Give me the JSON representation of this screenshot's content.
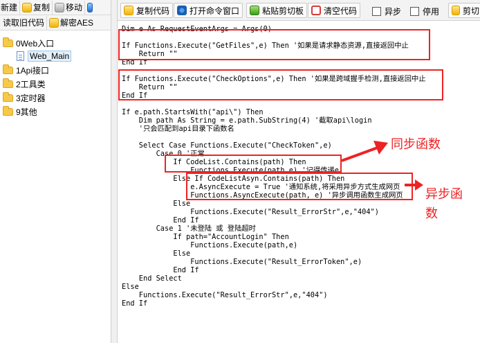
{
  "left_toolbar": {
    "row1": [
      {
        "label": "新建",
        "icon": "new-icon"
      },
      {
        "label": "复制",
        "icon": "copy-icon"
      },
      {
        "label": "移动",
        "icon": "move-icon"
      }
    ],
    "row2": [
      {
        "label": "读取旧代码"
      },
      {
        "label": "解密AES",
        "icon": "unlock-icon"
      }
    ]
  },
  "tree": {
    "items": [
      {
        "label": "0Web入口",
        "type": "folder",
        "level": 0
      },
      {
        "label": "Web_Main",
        "type": "file",
        "level": 1,
        "selected": true
      },
      {
        "label": "1Api接口",
        "type": "folder",
        "level": 0
      },
      {
        "label": "2工具类",
        "type": "folder",
        "level": 0
      },
      {
        "label": "3定时器",
        "type": "folder",
        "level": 0
      },
      {
        "label": "9其他",
        "type": "folder",
        "level": 0
      }
    ]
  },
  "right_toolbar": {
    "copy_code": "复制代码",
    "open_cmd": "打开命令窗口",
    "paste": "粘贴剪切板",
    "clear": "清空代码",
    "async": "异步",
    "stop": "停用",
    "cut": "剪切"
  },
  "code_lines": [
    "Dim e As RequestEventArgs = Args(0)",
    "",
    "If Functions.Execute(\"GetFiles\",e) Then '如果是请求静态资源,直接返回中止",
    "    Return \"\"",
    "End If",
    "",
    "If Functions.Execute(\"CheckOptions\",e) Then '如果是跨域握手检测,直接返回中止",
    "    Return \"\"",
    "End If",
    "",
    "If e.path.StartsWith(\"api\\\") Then",
    "    Dim path As String = e.path.SubString(4) '截取api\\login",
    "    '只会匹配到api目录下函数名",
    "",
    "    Select Case Functions.Execute(\"CheckToken\",e)",
    "        Case 0 '正常",
    "            If CodeList.Contains(path) Then",
    "                Functions.Execute(path,e) '记得传递e",
    "            Else If CodeListAsyn.Contains(path) Then",
    "                e.AsyncExecute = True '通知系统,将采用异步方式生成网页",
    "                Functions.AsyncExecute(path, e) '异步调用函数生成网页",
    "            Else",
    "                Functions.Execute(\"Result_ErrorStr\",e,\"404\")",
    "            End If",
    "        Case 1 '未登陆 或 登陆超时",
    "            If path=\"AccountLogin\" Then",
    "                Functions.Execute(path,e)",
    "            Else",
    "                Functions.Execute(\"Result_ErrorToken\",e)",
    "            End If",
    "    End Select",
    "Else",
    "    Functions.Execute(\"Result_ErrorStr\",e,\"404\")",
    "End If"
  ],
  "annotations": {
    "sync": "同步函数",
    "async_line1": "异步函",
    "async_line2": "数"
  },
  "colors": {
    "annotation": "#ee2222",
    "selection": "#e5f1fb"
  }
}
